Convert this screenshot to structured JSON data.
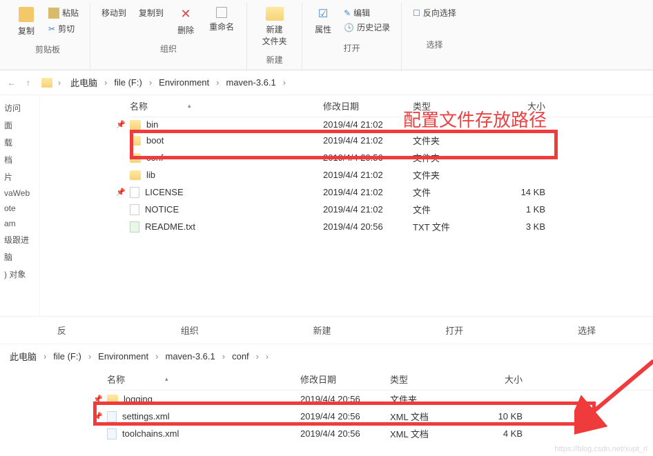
{
  "ribbon": {
    "copy": "复制",
    "paste": "粘贴",
    "cut": "剪切",
    "moveTo": "移动到",
    "copyTo": "复制到",
    "delete": "删除",
    "rename": "重命名",
    "newFolder": "新建\n文件夹",
    "properties": "属性",
    "edit": "编辑",
    "history": "历史记录",
    "invertSel": "反向选择",
    "groups": {
      "clipboard": "剪贴板",
      "organize": "组织",
      "new": "新建",
      "open": "打开",
      "select": "选择"
    }
  },
  "breadcrumb1": [
    "此电脑",
    "file (F:)",
    "Environment",
    "maven-3.6.1"
  ],
  "columns": {
    "name": "名称",
    "date": "修改日期",
    "type": "类型",
    "size": "大小"
  },
  "sidebar": [
    "访问",
    "面",
    "载",
    "档",
    "片",
    "vaWeb",
    "ote",
    "am",
    "级跟进",
    "脑",
    ") 对象",
    "反"
  ],
  "annotation1": "配置文件存放路径",
  "files1": [
    {
      "name": "bin",
      "date": "2019/4/4 21:02",
      "type": "",
      "size": "",
      "icon": "folder",
      "pinned": true
    },
    {
      "name": "boot",
      "date": "2019/4/4 21:02",
      "type": "文件夹",
      "size": "",
      "icon": "folder"
    },
    {
      "name": "conf",
      "date": "2019/4/4 20:56",
      "type": "文件夹",
      "size": "",
      "icon": "folder"
    },
    {
      "name": "lib",
      "date": "2019/4/4 21:02",
      "type": "文件夹",
      "size": "",
      "icon": "folder"
    },
    {
      "name": "LICENSE",
      "date": "2019/4/4 21:02",
      "type": "文件",
      "size": "14 KB",
      "icon": "file",
      "pinned": true
    },
    {
      "name": "NOTICE",
      "date": "2019/4/4 21:02",
      "type": "文件",
      "size": "1 KB",
      "icon": "file"
    },
    {
      "name": "README.txt",
      "date": "2019/4/4 20:56",
      "type": "TXT 文件",
      "size": "3 KB",
      "icon": "txt"
    }
  ],
  "lowerRibbon": {
    "organize": "组织",
    "new": "新建",
    "open": "打开",
    "select": "选择"
  },
  "breadcrumb2": [
    "此电脑",
    "file (F:)",
    "Environment",
    "maven-3.6.1",
    "conf"
  ],
  "files2": [
    {
      "name": "logging",
      "date": "2019/4/4 20:56",
      "type": "文件夹",
      "size": "",
      "icon": "folder",
      "pinned": true
    },
    {
      "name": "settings.xml",
      "date": "2019/4/4 20:56",
      "type": "XML 文档",
      "size": "10 KB",
      "icon": "xml",
      "pinned": true
    },
    {
      "name": "toolchains.xml",
      "date": "2019/4/4 20:56",
      "type": "XML 文档",
      "size": "4 KB",
      "icon": "xml"
    }
  ],
  "watermark": "https://blog.csdn.net/xupt_rl"
}
